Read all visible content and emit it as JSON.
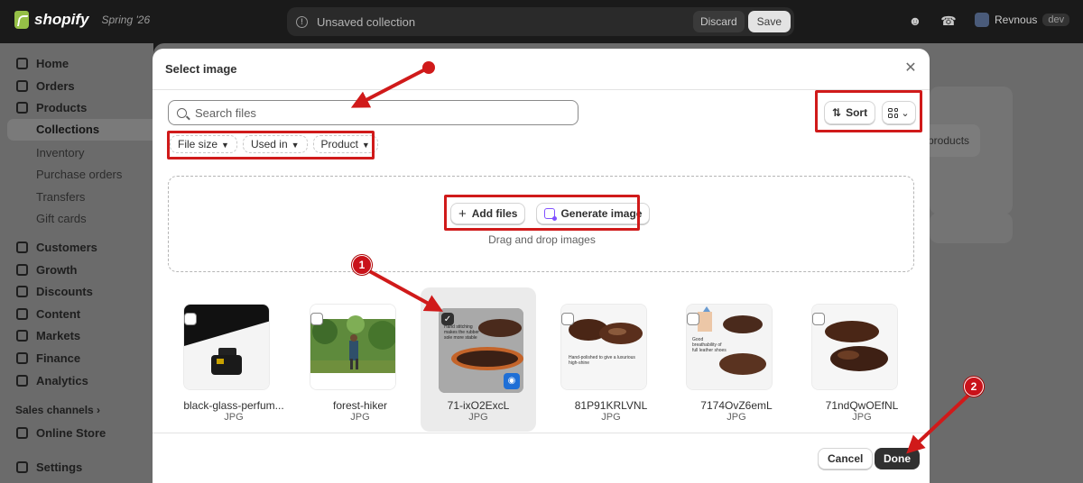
{
  "topbar": {
    "brand": "shopify",
    "edition": "Spring '26",
    "unsaved_text": "Unsaved collection",
    "discard_label": "Discard",
    "save_label": "Save",
    "store_name": "Revnous",
    "store_badge": "dev"
  },
  "sidebar": {
    "items": [
      {
        "label": "Home",
        "icon": "home-icon"
      },
      {
        "label": "Orders",
        "icon": "orders-icon"
      },
      {
        "label": "Products",
        "icon": "tag-icon"
      }
    ],
    "product_subitems": [
      "Collections",
      "Inventory",
      "Purchase orders",
      "Transfers",
      "Gift cards"
    ],
    "items2": [
      {
        "label": "Customers",
        "icon": "person-icon"
      },
      {
        "label": "Growth",
        "icon": "growth-icon"
      },
      {
        "label": "Discounts",
        "icon": "discount-icon"
      },
      {
        "label": "Content",
        "icon": "content-icon"
      },
      {
        "label": "Markets",
        "icon": "globe-icon"
      },
      {
        "label": "Finance",
        "icon": "finance-icon"
      },
      {
        "label": "Analytics",
        "icon": "analytics-icon"
      }
    ],
    "sales_channels_label": "Sales channels",
    "online_store": "Online Store",
    "settings": "Settings"
  },
  "background": {
    "products_button": "products"
  },
  "modal": {
    "title": "Select image",
    "search_placeholder": "Search files",
    "filters": [
      "File size",
      "Used in",
      "Product"
    ],
    "sort_label": "Sort",
    "add_files_label": "Add files",
    "generate_image_label": "Generate image",
    "dropzone_hint": "Drag and drop images",
    "files": [
      {
        "name": "black-glass-perfum...",
        "type": "JPG",
        "selected": false
      },
      {
        "name": "forest-hiker",
        "type": "JPG",
        "selected": false
      },
      {
        "name": "71-ixO2ExcL",
        "type": "JPG",
        "selected": true,
        "caption": "Hand stitching makes the rubber sole more stable"
      },
      {
        "name": "81P91KRLVNL",
        "type": "JPG",
        "selected": false,
        "caption": "Hand-polished to give a luxurious high-shine"
      },
      {
        "name": "7174OvZ6emL",
        "type": "JPG",
        "selected": false,
        "caption": "Good breathability of full leather shoes"
      },
      {
        "name": "71ndQwOEfNL",
        "type": "JPG",
        "selected": false
      }
    ],
    "cancel_label": "Cancel",
    "done_label": "Done"
  },
  "annotations": {
    "badge_1": "1",
    "badge_2": "2",
    "color": "#d01a1a"
  }
}
